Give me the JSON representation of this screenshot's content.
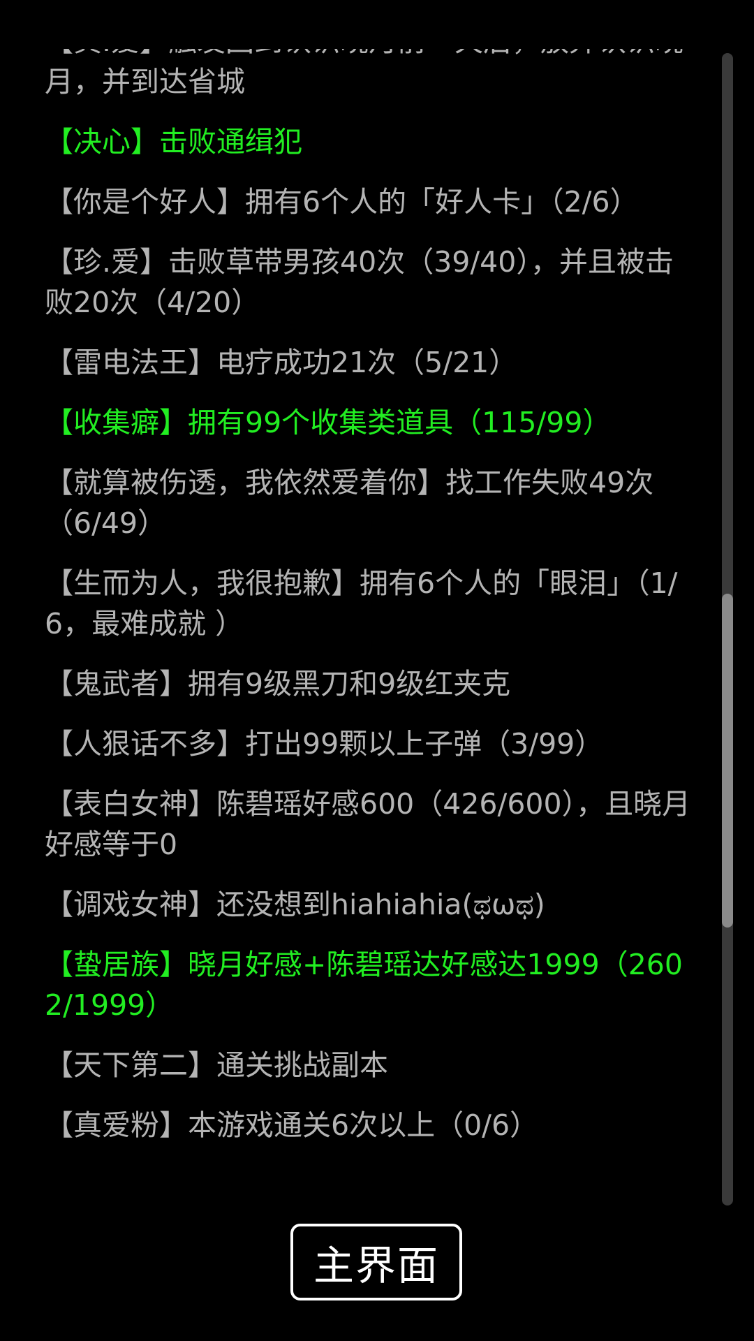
{
  "colors": {
    "done": "#22ee22",
    "pending": "#b4b4b4",
    "background": "#000000"
  },
  "achievements": [
    {
      "text": "【真.爱】触发回到认识晓月前一天后，放弃认识晓月，并到达省城",
      "done": false
    },
    {
      "text": "【决心】击败通缉犯",
      "done": true
    },
    {
      "text": "【你是个好人】拥有6个人的「好人卡」（2/6）",
      "done": false
    },
    {
      "text": "【珍.爱】击败草带男孩40次（39/40），并且被击败20次（4/20）",
      "done": false
    },
    {
      "text": "【雷电法王】电疗成功21次（5/21）",
      "done": false
    },
    {
      "text": "【收集癖】拥有99个收集类道具（115/99）",
      "done": true
    },
    {
      "text": "【就算被伤透，我依然爱着你】找工作失败49次（6/49）",
      "done": false
    },
    {
      "text": "【生而为人，我很抱歉】拥有6个人的「眼泪」（1/6，最难成就 ）",
      "done": false
    },
    {
      "text": "【鬼武者】拥有9级黑刀和9级红夹克",
      "done": false
    },
    {
      "text": "【人狠话不多】打出99颗以上子弹（3/99）",
      "done": false
    },
    {
      "text": "【表白女神】陈碧瑶好感600（426/600），且晓月好感等于0",
      "done": false
    },
    {
      "text": "【调戏女神】还没想到hiahiahia(ಥωಥ)",
      "done": false
    },
    {
      "text": "【蛰居族】晓月好感+陈碧瑶达好感达1999（2602/1999）",
      "done": true
    },
    {
      "text": "【天下第二】通关挑战副本",
      "done": false
    },
    {
      "text": "【真爱粉】本游戏通关6次以上（0/6）",
      "done": false
    }
  ],
  "scrollbar": {
    "position_fraction": 0.66,
    "thumb_fraction": 0.29
  },
  "main_button": {
    "label": "主界面"
  }
}
